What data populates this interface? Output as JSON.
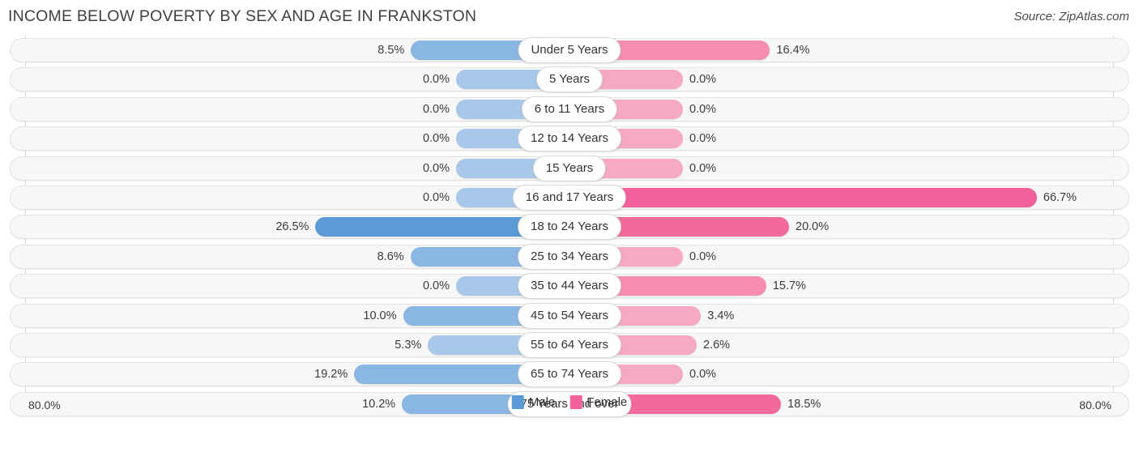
{
  "header": {
    "title": "INCOME BELOW POVERTY BY SEX AND AGE IN FRANKSTON",
    "source": "Source: ZipAtlas.com"
  },
  "axis": {
    "left_label": "80.0%",
    "right_label": "80.0%",
    "max": 80.0
  },
  "legend": {
    "male_label": "Male",
    "female_label": "Female",
    "male_color": "#5b9bd5",
    "female_color": "#f4needs"
  },
  "colors": {
    "male_light": "#a8c8ea",
    "male_mid": "#8ab6e3",
    "male_dark": "#5b9bd5",
    "female_light": "#f7a8c4",
    "female_mid": "#f58db1",
    "female_dark": "#f2699b",
    "female_vivid": "#f2619a"
  },
  "chart_data": {
    "type": "bar",
    "orientation": "horizontal-diverging",
    "title": "INCOME BELOW POVERTY BY SEX AND AGE IN FRANKSTON",
    "xlabel": "",
    "ylabel": "",
    "xlim": [
      80.0,
      80.0
    ],
    "grid": true,
    "legend_position": "bottom-center",
    "categories": [
      "Under 5 Years",
      "5 Years",
      "6 to 11 Years",
      "12 to 14 Years",
      "15 Years",
      "16 and 17 Years",
      "18 to 24 Years",
      "25 to 34 Years",
      "35 to 44 Years",
      "45 to 54 Years",
      "55 to 64 Years",
      "65 to 74 Years",
      "75 Years and over"
    ],
    "series": [
      {
        "name": "Male",
        "values": [
          8.5,
          0.0,
          0.0,
          0.0,
          0.0,
          0.0,
          26.5,
          8.6,
          0.0,
          10.0,
          5.3,
          19.2,
          10.2
        ],
        "labels": [
          "8.5%",
          "0.0%",
          "0.0%",
          "0.0%",
          "0.0%",
          "0.0%",
          "26.5%",
          "8.6%",
          "0.0%",
          "10.0%",
          "5.3%",
          "19.2%",
          "10.2%"
        ]
      },
      {
        "name": "Female",
        "values": [
          16.4,
          0.0,
          0.0,
          0.0,
          0.0,
          66.7,
          20.0,
          0.0,
          15.7,
          3.4,
          2.6,
          0.0,
          18.5
        ],
        "labels": [
          "16.4%",
          "0.0%",
          "0.0%",
          "0.0%",
          "0.0%",
          "66.7%",
          "20.0%",
          "0.0%",
          "15.7%",
          "3.4%",
          "2.6%",
          "0.0%",
          "18.5%"
        ]
      }
    ]
  }
}
